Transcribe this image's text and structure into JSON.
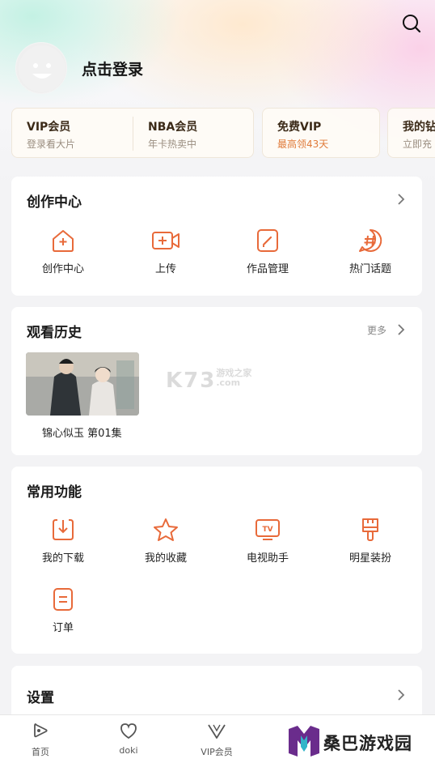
{
  "header": {
    "login_text": "点击登录"
  },
  "vip_cards": [
    {
      "title": "VIP会员",
      "subtitle": "登录看大片"
    },
    {
      "title": "NBA会员",
      "subtitle": "年卡热卖中"
    },
    {
      "title": "免费VIP",
      "subtitle": "最高领43天"
    },
    {
      "title": "我的钻",
      "subtitle": "立即充"
    }
  ],
  "creation": {
    "title": "创作中心",
    "items": [
      {
        "label": "创作中心",
        "icon": "house-plus-icon"
      },
      {
        "label": "上传",
        "icon": "video-upload-icon"
      },
      {
        "label": "作品管理",
        "icon": "edit-icon"
      },
      {
        "label": "热门话题",
        "icon": "hashtag-icon"
      }
    ]
  },
  "history": {
    "title": "观看历史",
    "more_label": "更多",
    "items": [
      {
        "label": "锦心似玉 第01集"
      }
    ]
  },
  "watermark": {
    "main": "K73",
    "sub1": "游戏之家",
    "sub2": ".com"
  },
  "functions": {
    "title": "常用功能",
    "items": [
      {
        "label": "我的下载",
        "icon": "download-icon"
      },
      {
        "label": "我的收藏",
        "icon": "star-icon"
      },
      {
        "label": "电视助手",
        "icon": "tv-icon"
      },
      {
        "label": "明星装扮",
        "icon": "brush-icon"
      },
      {
        "label": "订单",
        "icon": "order-icon"
      }
    ]
  },
  "settings": {
    "title": "设置"
  },
  "bottom_nav": [
    {
      "label": "首页",
      "icon": "home-play-icon"
    },
    {
      "label": "doki",
      "icon": "doki-icon"
    },
    {
      "label": "VIP会员",
      "icon": "vip-v-icon"
    }
  ],
  "brand": {
    "text": "桑巴游戏园"
  },
  "colors": {
    "accent": "#e86a3a",
    "vip_gold": "#3b2a18"
  }
}
